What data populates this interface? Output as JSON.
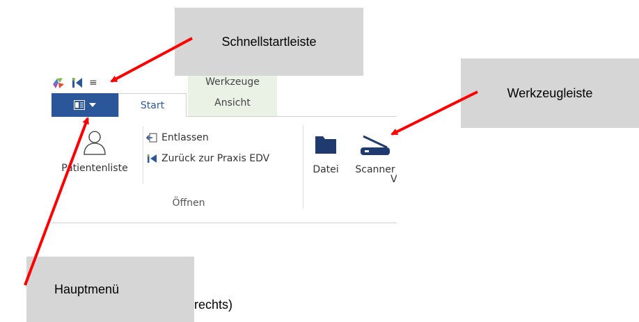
{
  "ribbon": {
    "contextual_group": "Werkzeuge",
    "tabs": {
      "start": "Start",
      "ansicht": "Ansicht"
    },
    "open_group": {
      "patientenliste": "Patientenliste",
      "entlassen": "Entlassen",
      "zurueck": "Zurück zur Praxis EDV",
      "label": "Öffnen"
    },
    "tools_group": {
      "datei": "Datei",
      "scanner": "Scanner",
      "truncated": "V"
    }
  },
  "callouts": {
    "schnellstartleiste": "Schnellstartleiste",
    "werkzeugleiste": "Werkzeugleiste",
    "hauptmenue": "Hauptmenü"
  },
  "caption_fragment": "rechts)",
  "colors": {
    "accent_blue": "#2b579a",
    "arrow_red": "#ff0000",
    "callout_gray": "#d6d6d6",
    "context_green": "#e9f2e4",
    "folder_navy": "#1f3a6e"
  },
  "icons": {
    "qat": [
      "app-logo-icon",
      "back-to-start-icon",
      "customize-qat-icon"
    ],
    "app_menu": [
      "document-icon",
      "dropdown-arrow-icon"
    ],
    "ribbon": [
      "person-icon",
      "exit-icon",
      "back-icon",
      "folder-icon",
      "scanner-icon"
    ]
  }
}
